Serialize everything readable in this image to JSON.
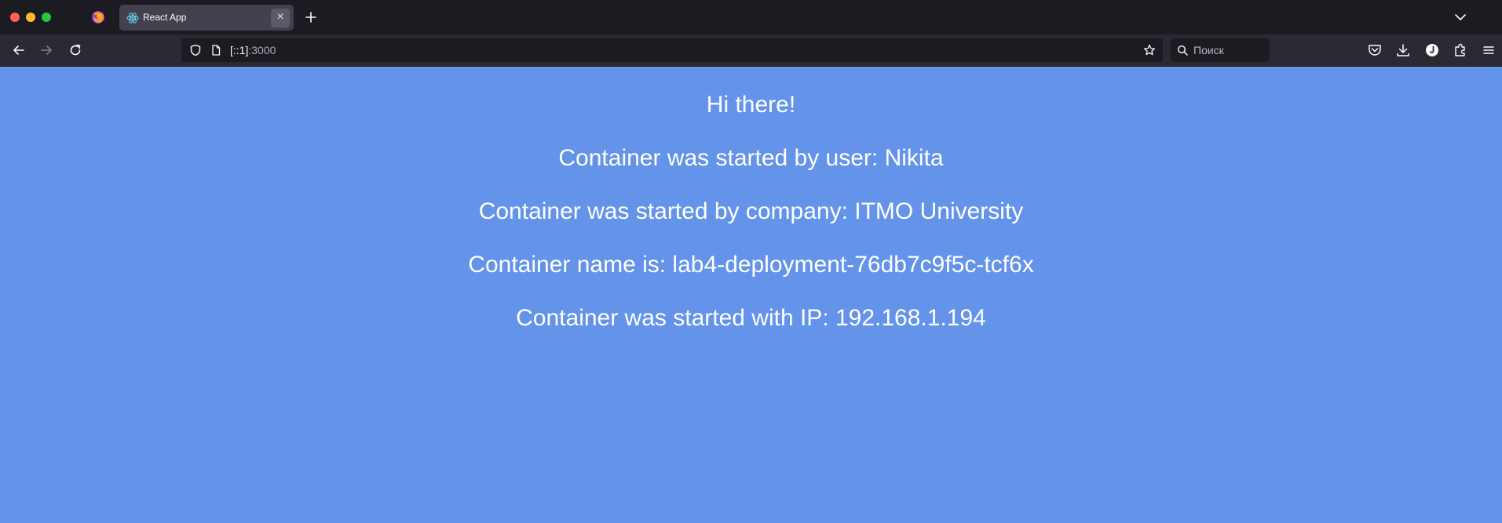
{
  "browser": {
    "tab": {
      "title": "React App",
      "close_symbol": "×"
    },
    "address": {
      "host": "[::1]",
      "port": ":3000"
    },
    "search": {
      "placeholder": "Поиск"
    },
    "colors": {
      "chrome": "#1c1b22",
      "toolbar": "#2b2a33",
      "page_bg": "#6494ea"
    },
    "icons": [
      "firefox-logo-icon",
      "react-favicon-icon",
      "close-icon",
      "plus-icon",
      "chevron-down-icon",
      "back-arrow-icon",
      "forward-arrow-icon",
      "reload-icon",
      "shield-icon",
      "page-icon",
      "star-icon",
      "search-icon",
      "pocket-icon",
      "download-icon",
      "account-icon",
      "extensions-icon",
      "menu-icon"
    ]
  },
  "page": {
    "greeting": "Hi there!",
    "user_line": "Container was started by user: Nikita",
    "company_line": "Container was started by company: ITMO University",
    "name_line": "Container name is: lab4-deployment-76db7c9f5c-tcf6x",
    "ip_line": "Container was started with IP: 192.168.1.194"
  }
}
